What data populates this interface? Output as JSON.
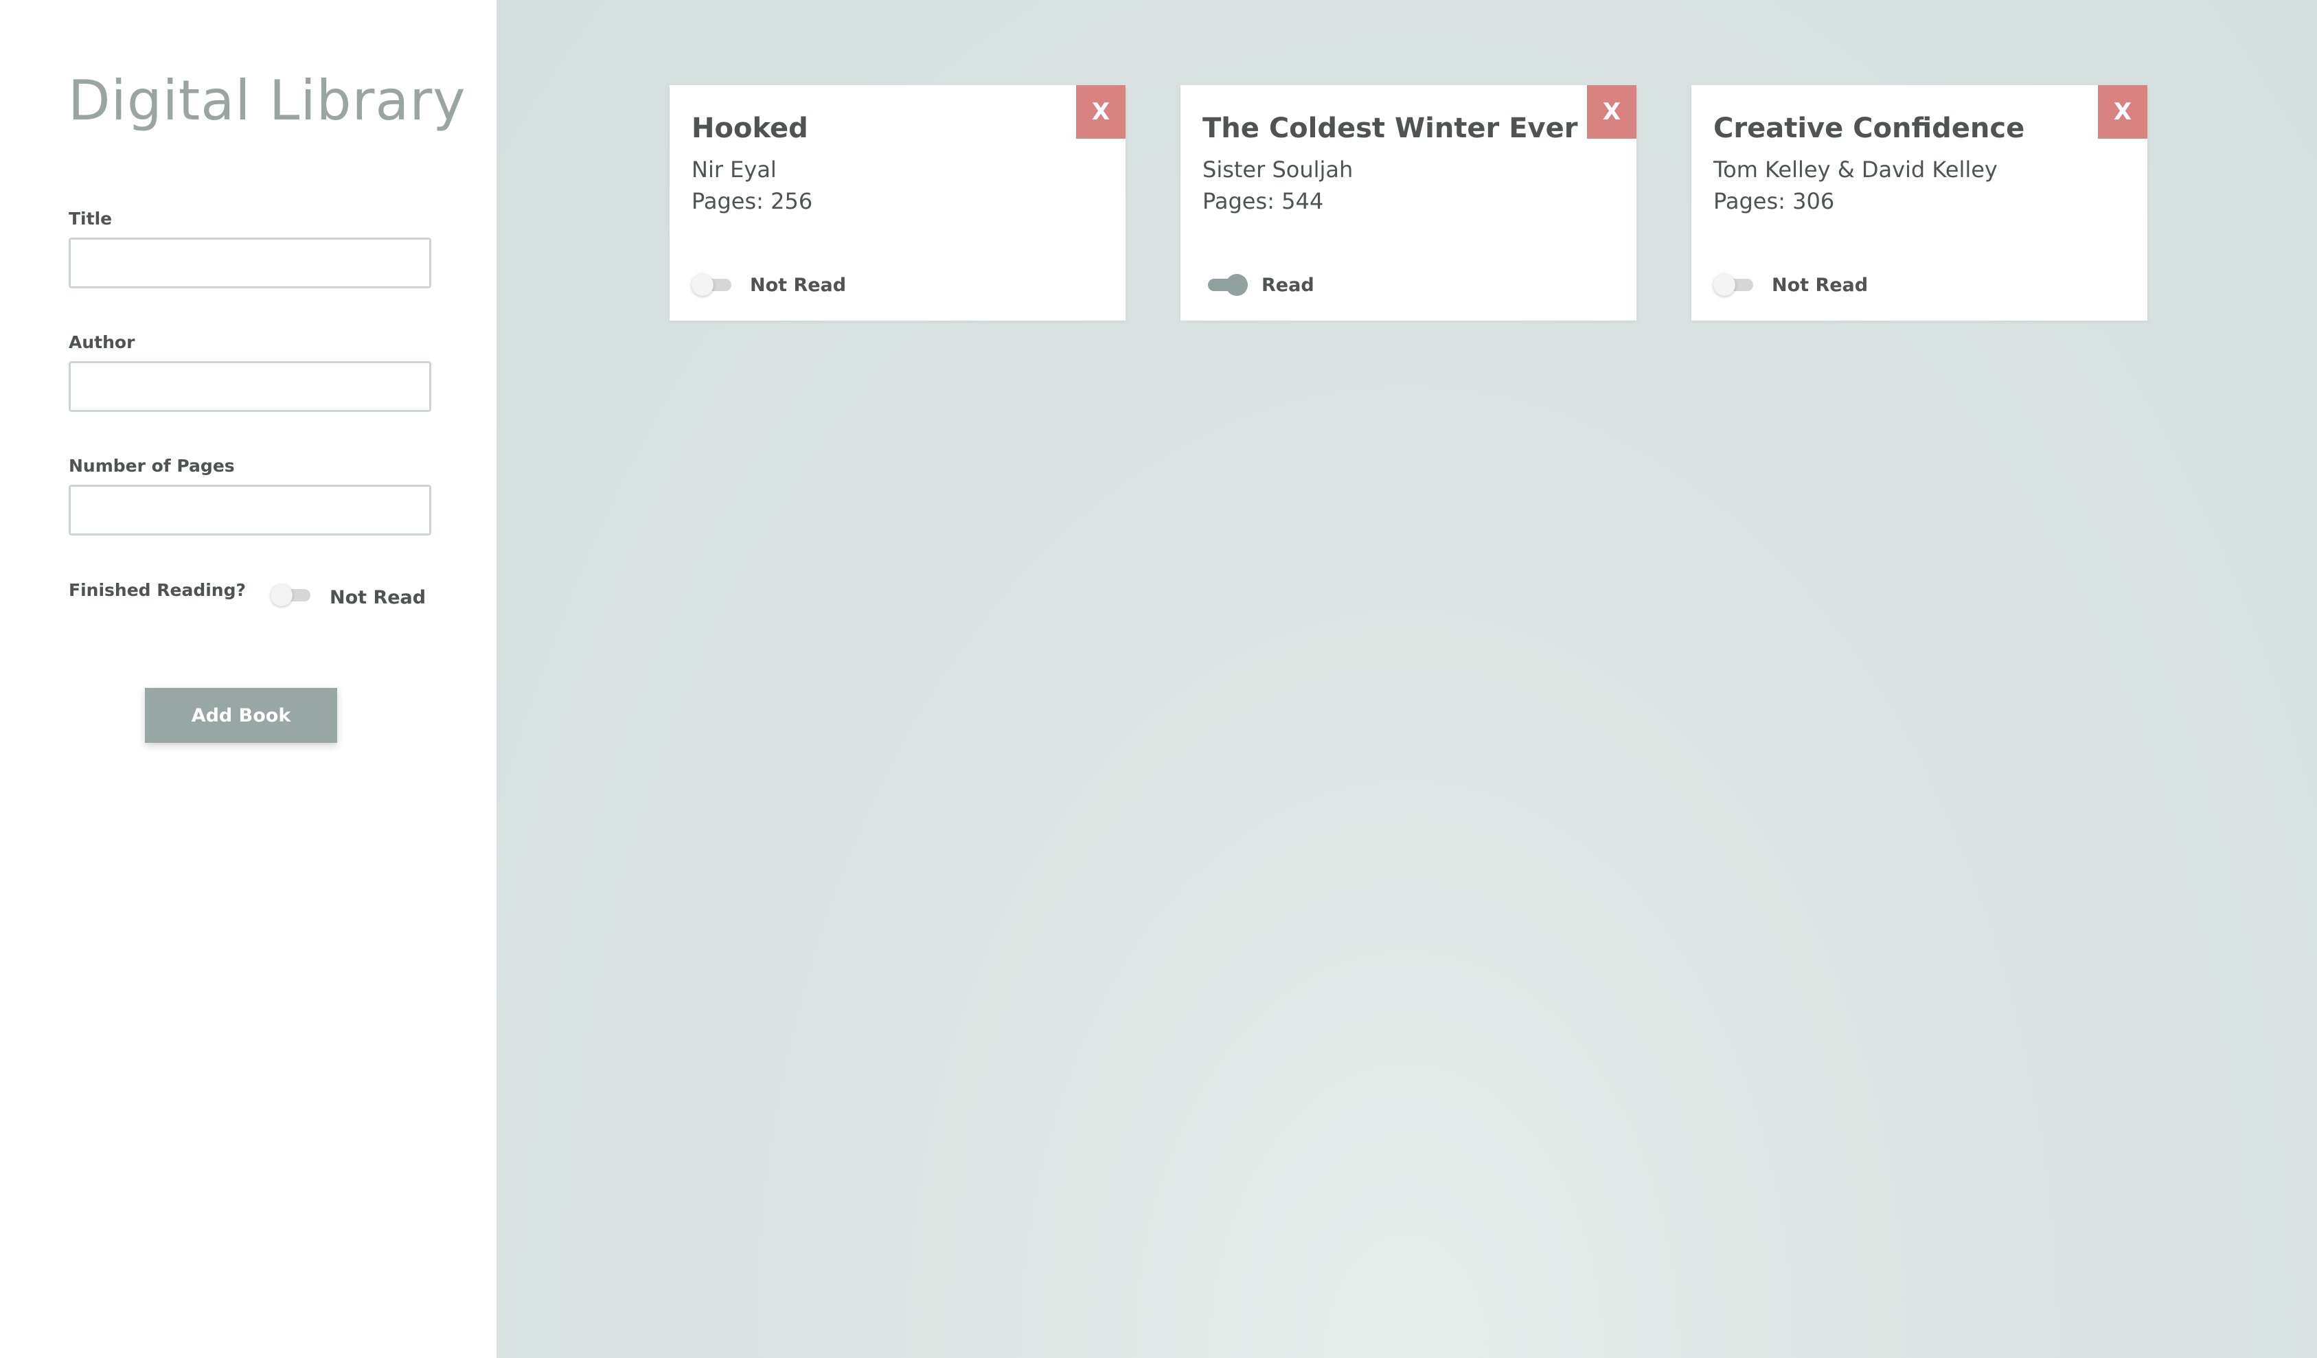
{
  "app": {
    "title": "Digital Library"
  },
  "form": {
    "title_label": "Title",
    "title_value": "",
    "author_label": "Author",
    "author_value": "",
    "pages_label": "Number of Pages",
    "pages_value": "",
    "finished_label": "Finished Reading?",
    "finished_status": "Not Read",
    "finished_checked": false,
    "add_button_label": "Add Book"
  },
  "books": [
    {
      "title": "Hooked",
      "author": "Nir Eyal",
      "pages": "Pages: 256",
      "status": "Not Read",
      "read": false,
      "delete_label": "X"
    },
    {
      "title": "The Coldest Winter Ever",
      "author": "Sister Souljah",
      "pages": "Pages: 544",
      "status": "Read",
      "read": true,
      "delete_label": "X"
    },
    {
      "title": "Creative Confidence",
      "author": "Tom Kelley & David Kelley",
      "pages": "Pages: 306",
      "status": "Not Read",
      "read": false,
      "delete_label": "X"
    }
  ],
  "colors": {
    "sidebar_bg": "#ffffff",
    "main_bg": "#dce4e3",
    "accent": "#98a6a4",
    "delete": "#d98381",
    "title_text": "#9aa5a3",
    "body_text": "#4f5352"
  }
}
